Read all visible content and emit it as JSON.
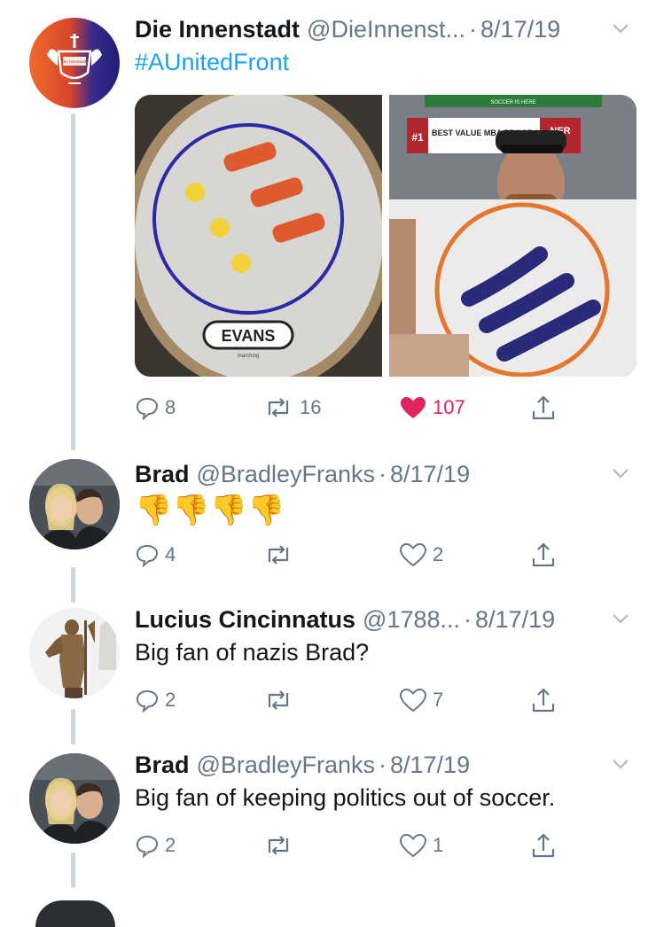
{
  "tweets": [
    {
      "name": "Die Innenstadt",
      "handle": "@DieInnenst...",
      "date": "8/17/19",
      "text": "#AUnitedFront",
      "avatar_logo_text": "Die Innenstadt",
      "media": {
        "left_image_label": "EVANS",
        "left_image_sublabel": "marching",
        "right_image_banner": "BEST VALUE MBA PROGRAM",
        "right_image_banner_rank": "#1",
        "right_image_banner_tail": "NER",
        "right_image_top_text": "SOCCER IS HERE"
      },
      "actions": {
        "replies": "8",
        "retweets": "16",
        "likes": "107",
        "liked": true
      }
    },
    {
      "name": "Brad",
      "handle": "@BradleyFranks",
      "date": "8/17/19",
      "text": "👎👎👎👎",
      "actions": {
        "replies": "4",
        "retweets": "",
        "likes": "2",
        "liked": false
      }
    },
    {
      "name": "Lucius Cincinnatus",
      "handle": "@1788...",
      "date": "8/17/19",
      "text": "Big fan of nazis Brad?",
      "actions": {
        "replies": "2",
        "retweets": "",
        "likes": "7",
        "liked": false
      }
    },
    {
      "name": "Brad",
      "handle": "@BradleyFranks",
      "date": "8/17/19",
      "text": "Big fan of keeping politics out of soccer.",
      "actions": {
        "replies": "2",
        "retweets": "",
        "likes": "1",
        "liked": false
      }
    }
  ],
  "colors": {
    "link": "#1da1f2",
    "muted": "#657786",
    "like": "#e0245e",
    "thread_line": "#ccd6dd"
  }
}
